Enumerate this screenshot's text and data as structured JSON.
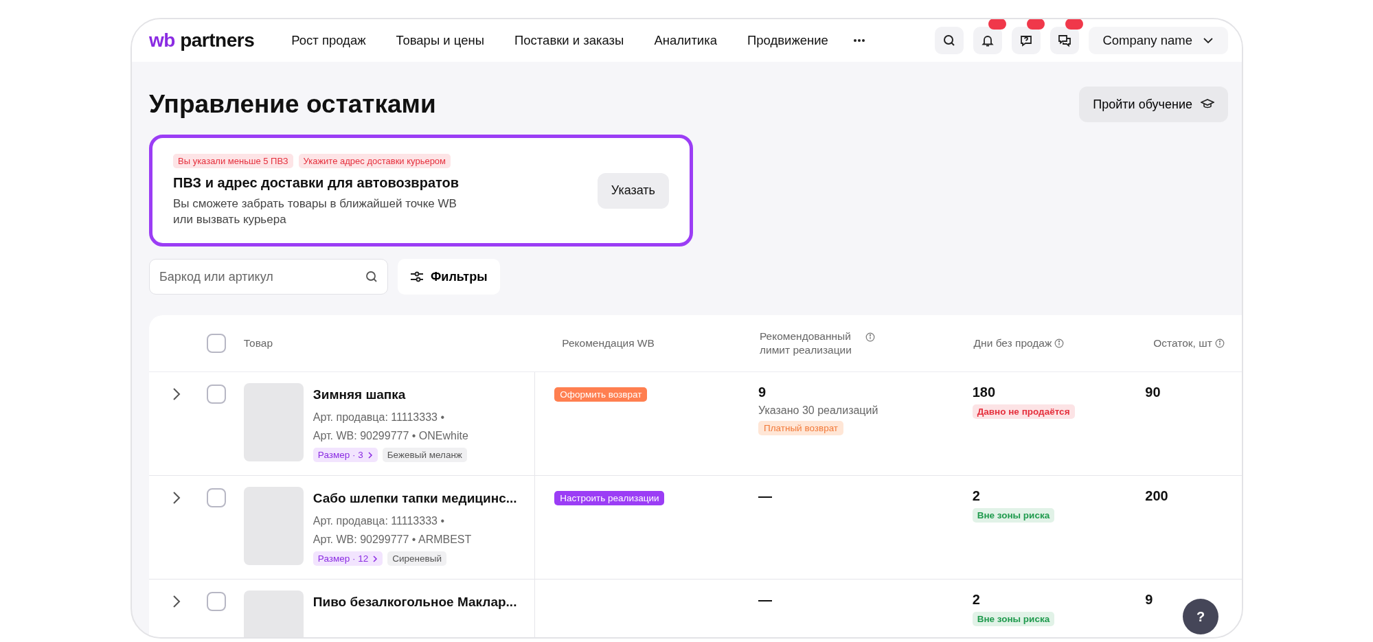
{
  "logo": {
    "accent": "wb",
    "text": "partners"
  },
  "nav": {
    "items": [
      "Рост продаж",
      "Товары и цены",
      "Поставки и заказы",
      "Аналитика",
      "Продвижение"
    ]
  },
  "account": {
    "label": "Company name"
  },
  "page": {
    "title": "Управление остатками",
    "tutorial_button": "Пройти обучение"
  },
  "banner": {
    "tags": [
      "Вы указали меньше 5 ПВЗ",
      "Укажите адрес доставки курьером"
    ],
    "title": "ПВЗ и адрес доставки для автовозвратов",
    "text": "Вы сможете забрать товары в ближайшей точке WB\nили вызвать курьера",
    "button": "Указать"
  },
  "search": {
    "placeholder": "Баркод или артикул"
  },
  "filters_button": "Фильтры",
  "table": {
    "all_selected": false,
    "columns": [
      {
        "label": "Товар",
        "info": false
      },
      {
        "label": "Рекомендация WB",
        "info": false
      },
      {
        "label": "Рекомендованный лимит реализации",
        "info": true
      },
      {
        "label": "Дни без продаж",
        "info": true
      },
      {
        "label": "Остаток, шт",
        "info": true
      }
    ],
    "rows": [
      {
        "selected": false,
        "name": "Зимняя шапка",
        "lines": [
          "Арт. продавца: 11113333 •",
          "Арт. WB: 90299777 • ONEwhite"
        ],
        "size": "Размер · 3",
        "variant": "Бежевый меланж",
        "recommendation": {
          "label": "Оформить возврат",
          "color": "#ff7f50"
        },
        "limit": {
          "value": "9",
          "note": "Указано 30 реализаций",
          "tag": "Платный возврат"
        },
        "days": {
          "value": "180",
          "status": "Давно не продаётся",
          "color": "#e5303d"
        },
        "stock": "90"
      },
      {
        "selected": false,
        "name": "Сабо шлепки тапки медицинс...",
        "lines": [
          "Арт. продавца: 11113333 •",
          "Арт. WB: 90299777 • ARMBEST"
        ],
        "size": "Размер · 12",
        "variant": "Сиреневый",
        "recommendation": {
          "label": "Настроить реализации",
          "color": "#9b3df5"
        },
        "limit": {
          "value": "—"
        },
        "days": {
          "value": "2",
          "status": "Вне зоны риска",
          "color": "#1f9a4d"
        },
        "stock": "200"
      },
      {
        "selected": false,
        "name": "Пиво безалкогольное Маклар...",
        "lines": [],
        "limit": {
          "value": "—"
        },
        "days": {
          "value": "2",
          "status": "Вне зоны риска",
          "color": "#1f9a4d"
        },
        "stock": "9"
      }
    ]
  },
  "help_button": "?"
}
